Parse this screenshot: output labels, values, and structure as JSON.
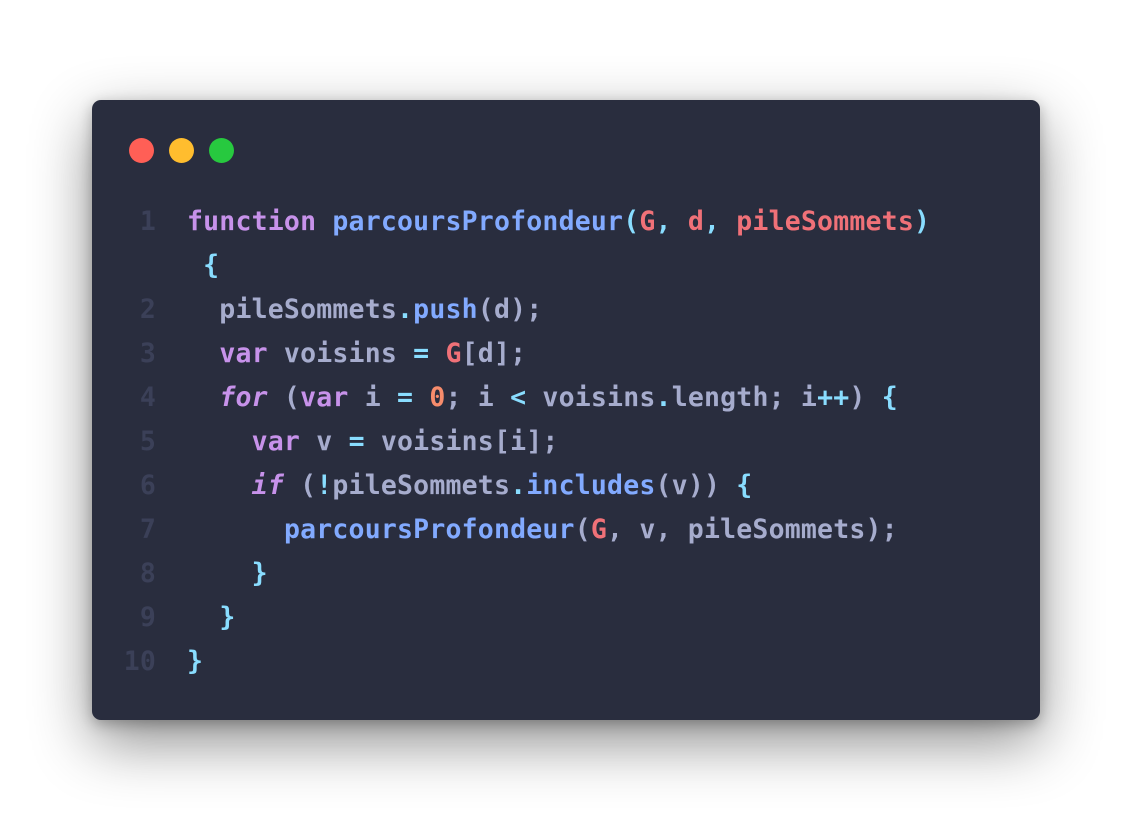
{
  "colors": {
    "background": "#ffffff",
    "window": "#292d3e",
    "line_number": "#3b4058",
    "keyword": "#c792ea",
    "function": "#82aaff",
    "param": "#f07178",
    "text": "#a6accd",
    "punct": "#89ddff",
    "number": "#f78c6c"
  },
  "window_controls": [
    {
      "name": "close",
      "color": "#ff5f56"
    },
    {
      "name": "minimize",
      "color": "#ffbd2e"
    },
    {
      "name": "maximize",
      "color": "#27c93f"
    }
  ],
  "lines": [
    {
      "ln": "1",
      "tokens": [
        {
          "t": "function",
          "c": "keyword"
        },
        {
          "t": " ",
          "c": "text"
        },
        {
          "t": "parcoursProfondeur",
          "c": "function"
        },
        {
          "t": "(",
          "c": "punct"
        },
        {
          "t": "G",
          "c": "param"
        },
        {
          "t": ", ",
          "c": "punct"
        },
        {
          "t": "d",
          "c": "param"
        },
        {
          "t": ", ",
          "c": "punct"
        },
        {
          "t": "pileSommets",
          "c": "param"
        },
        {
          "t": ")",
          "c": "punct"
        }
      ]
    },
    {
      "ln": "",
      "tokens": [
        {
          "t": " {",
          "c": "punct"
        }
      ]
    },
    {
      "ln": "2",
      "tokens": [
        {
          "t": "  pileSommets",
          "c": "text"
        },
        {
          "t": ".",
          "c": "punct"
        },
        {
          "t": "push",
          "c": "function"
        },
        {
          "t": "(d);",
          "c": "text"
        }
      ]
    },
    {
      "ln": "3",
      "tokens": [
        {
          "t": "  ",
          "c": "text"
        },
        {
          "t": "var",
          "c": "keyword"
        },
        {
          "t": " voisins ",
          "c": "text"
        },
        {
          "t": "=",
          "c": "punct"
        },
        {
          "t": " ",
          "c": "text"
        },
        {
          "t": "G",
          "c": "param"
        },
        {
          "t": "[d];",
          "c": "text"
        }
      ]
    },
    {
      "ln": "4",
      "tokens": [
        {
          "t": "  ",
          "c": "text"
        },
        {
          "t": "for",
          "c": "keyword",
          "italic": true
        },
        {
          "t": " (",
          "c": "text"
        },
        {
          "t": "var",
          "c": "keyword"
        },
        {
          "t": " i ",
          "c": "text"
        },
        {
          "t": "=",
          "c": "punct"
        },
        {
          "t": " ",
          "c": "text"
        },
        {
          "t": "0",
          "c": "number"
        },
        {
          "t": "; i ",
          "c": "text"
        },
        {
          "t": "<",
          "c": "punct"
        },
        {
          "t": " voisins",
          "c": "text"
        },
        {
          "t": ".",
          "c": "punct"
        },
        {
          "t": "length; i",
          "c": "text"
        },
        {
          "t": "++",
          "c": "punct"
        },
        {
          "t": ") ",
          "c": "text"
        },
        {
          "t": "{",
          "c": "punct"
        }
      ]
    },
    {
      "ln": "5",
      "tokens": [
        {
          "t": "    ",
          "c": "text"
        },
        {
          "t": "var",
          "c": "keyword"
        },
        {
          "t": " v ",
          "c": "text"
        },
        {
          "t": "=",
          "c": "punct"
        },
        {
          "t": " voisins[i];",
          "c": "text"
        }
      ]
    },
    {
      "ln": "6",
      "tokens": [
        {
          "t": "    ",
          "c": "text"
        },
        {
          "t": "if",
          "c": "keyword",
          "italic": true
        },
        {
          "t": " (",
          "c": "text"
        },
        {
          "t": "!",
          "c": "punct"
        },
        {
          "t": "pileSommets",
          "c": "text"
        },
        {
          "t": ".",
          "c": "punct"
        },
        {
          "t": "includes",
          "c": "function"
        },
        {
          "t": "(v)) ",
          "c": "text"
        },
        {
          "t": "{",
          "c": "punct"
        }
      ]
    },
    {
      "ln": "7",
      "tokens": [
        {
          "t": "      ",
          "c": "text"
        },
        {
          "t": "parcoursProfondeur",
          "c": "function"
        },
        {
          "t": "(",
          "c": "text"
        },
        {
          "t": "G",
          "c": "param"
        },
        {
          "t": ", v, pileSommets);",
          "c": "text"
        }
      ]
    },
    {
      "ln": "8",
      "tokens": [
        {
          "t": "    ",
          "c": "text"
        },
        {
          "t": "}",
          "c": "punct"
        }
      ]
    },
    {
      "ln": "9",
      "tokens": [
        {
          "t": "  ",
          "c": "text"
        },
        {
          "t": "}",
          "c": "punct"
        }
      ]
    },
    {
      "ln": "10",
      "tokens": [
        {
          "t": "}",
          "c": "punct"
        }
      ]
    }
  ]
}
